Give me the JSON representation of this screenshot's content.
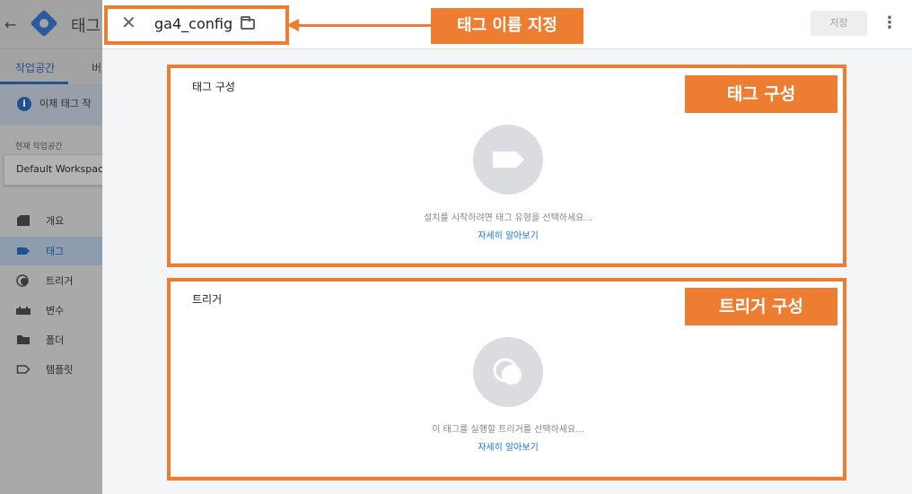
{
  "background_app": {
    "app_title": "태그",
    "tabs": {
      "workspace": "작업공간",
      "versions": "버"
    },
    "notice_text": "이제 태그 작",
    "workspace_label": "현재 작업공간",
    "workspace_name": "Default Workspace",
    "nav": [
      {
        "label": "개요",
        "icon": "overview-icon"
      },
      {
        "label": "태그",
        "icon": "tag-icon",
        "active": true
      },
      {
        "label": "트리거",
        "icon": "trigger-icon"
      },
      {
        "label": "변수",
        "icon": "variable-icon"
      },
      {
        "label": "폴더",
        "icon": "folder-icon"
      },
      {
        "label": "템플릿",
        "icon": "template-icon"
      }
    ]
  },
  "panel": {
    "tag_name": "ga4_config",
    "save_label": "저장",
    "config_card": {
      "title": "태그 구성",
      "description": "설치를 시작하려면 태그 유형을 선택하세요...",
      "link": "자세히 알아보기"
    },
    "trigger_card": {
      "title": "트리거",
      "description": "이 태그를 실행할 트리거를 선택하세요...",
      "link": "자세히 알아보기"
    }
  },
  "annotations": {
    "name_callout": "태그 이름 지정",
    "config_callout": "태그 구성",
    "trigger_callout": "트리거 구성",
    "color": "#ed7d31"
  }
}
